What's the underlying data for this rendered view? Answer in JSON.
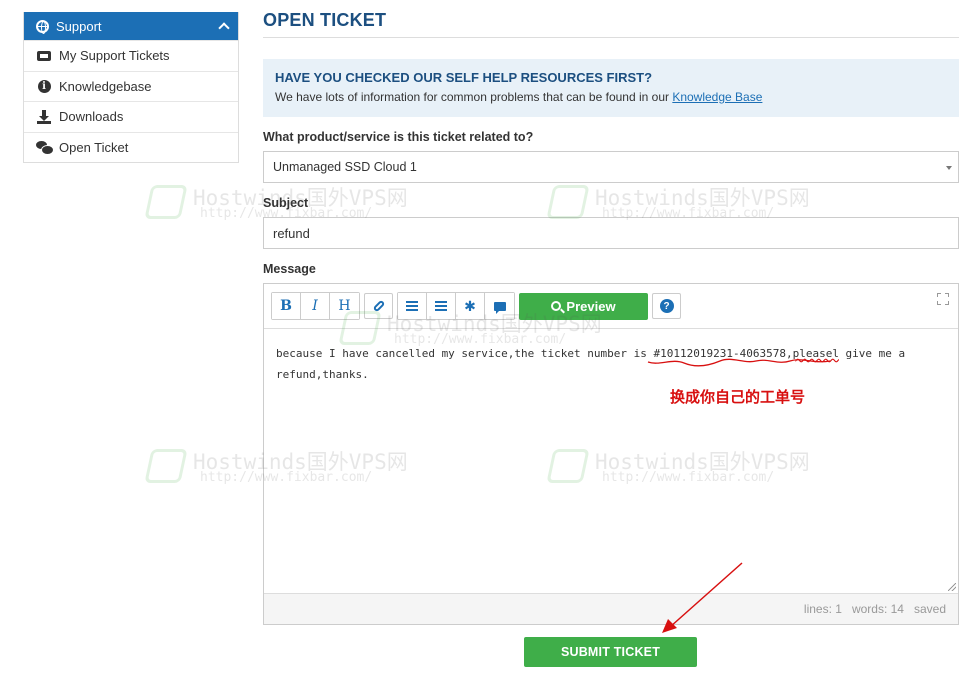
{
  "sidebar": {
    "header": "Support",
    "items": [
      {
        "label": "My Support Tickets",
        "icon": "ticket-icon"
      },
      {
        "label": "Knowledgebase",
        "icon": "info-icon"
      },
      {
        "label": "Downloads",
        "icon": "download-icon"
      },
      {
        "label": "Open Ticket",
        "icon": "comments-icon"
      }
    ]
  },
  "main": {
    "title": "OPEN TICKET",
    "help": {
      "title": "HAVE YOU CHECKED OUR SELF HELP RESOURCES FIRST?",
      "text": "We have lots of information for common problems that can be found in our ",
      "link": "Knowledge Base"
    },
    "product": {
      "label": "What product/service is this ticket related to?",
      "value": "Unmanaged SSD Cloud 1"
    },
    "subject": {
      "label": "Subject",
      "value": "refund"
    },
    "message": {
      "label": "Message",
      "preview_label": "Preview",
      "text_before": "because I have cancelled my service,the ticket number is ",
      "ticket_number": "#10112019231-4063578",
      "text_mid": ",",
      "misspelled": "pleasel",
      "text_after": " give me a refund,thanks.",
      "status": {
        "lines": "lines: 1",
        "words": "words: 14",
        "saved": "saved"
      }
    },
    "submit_label": "SUBMIT TICKET"
  },
  "annotation": {
    "note": "换成你自己的工单号",
    "color": "#d81010"
  },
  "watermark": {
    "name": "Hostwinds国外VPS网",
    "url": "http://www.fixbar.com/"
  },
  "colors": {
    "brand_blue": "#1c6fb5",
    "title_blue": "#1c4f80",
    "green": "#3fae49",
    "help_bg": "#e8f1f8"
  }
}
